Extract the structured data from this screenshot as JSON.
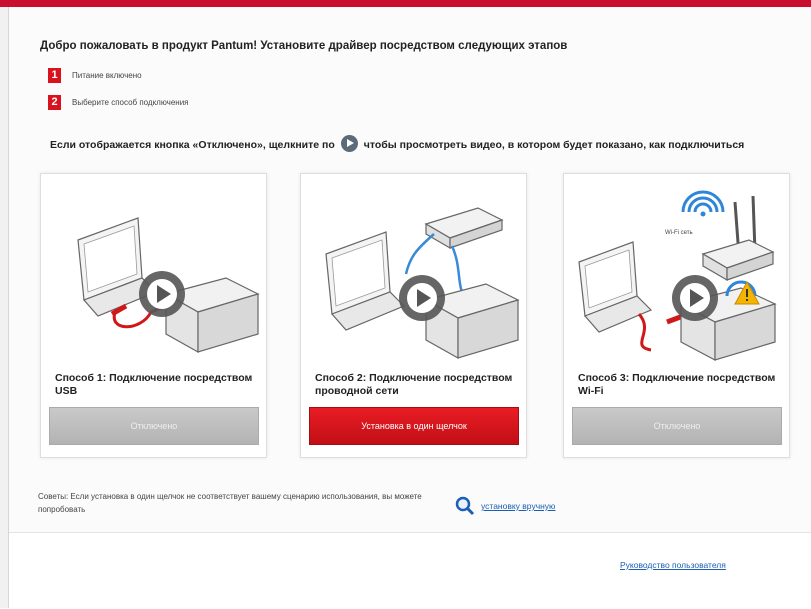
{
  "header": {
    "welcome": "Добро пожаловать в продукт Pantum! Установите драйвер посредством следующих этапов"
  },
  "steps": [
    {
      "num": "1",
      "text": "Питание включено"
    },
    {
      "num": "2",
      "text": "Выберите способ подключения"
    }
  ],
  "note": {
    "before": "Если отображается кнопка «Отключено», щелкните по",
    "after": "чтобы просмотреть видео, в котором будет показано, как подключиться"
  },
  "methods": [
    {
      "title": "Способ 1: Подключение посредством USB",
      "button": "Отключено",
      "active": false
    },
    {
      "title": "Способ 2: Подключение посредством проводной сети",
      "button": "Установка в один щелчок",
      "active": true
    },
    {
      "title": "Способ 3: Подключение посредством Wi-Fi",
      "button": "Отключено",
      "active": false
    }
  ],
  "tips": {
    "text": "Советы: Если установка в один щелчок не соответствует вашему сценарию использования, вы можете попробовать",
    "manual_link": "установку вручную"
  },
  "footer": {
    "user_guide": "Руководство пользователя"
  },
  "illustration": {
    "wifi_label": "Wi-Fi сеть"
  },
  "colors": {
    "accent": "#c8102e",
    "button_active": "#e0161e",
    "button_disabled": "#bdbdbd",
    "link": "#1a5fb4"
  }
}
